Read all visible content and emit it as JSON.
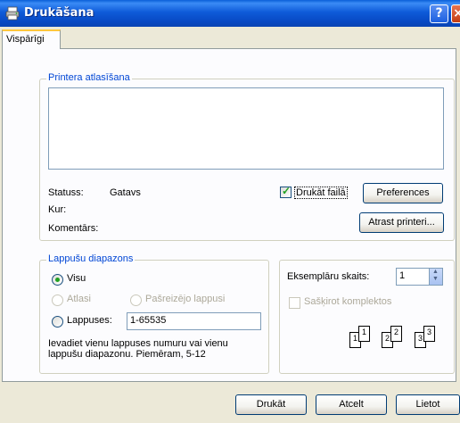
{
  "window": {
    "title": "Drukāšana",
    "help_label": "?",
    "close_label": "×"
  },
  "tabs": [
    "Vispārīgi"
  ],
  "printer_selection": {
    "title": "Printera atlasīšana",
    "status_label": "Statuss:",
    "status_value": "Gatavs",
    "location_label": "Kur:",
    "comment_label": "Komentārs:",
    "print_to_file_label": "Drukāt failā",
    "print_to_file_checked": true,
    "preferences_label": "Preferences",
    "find_printer_label": "Atrast printeri..."
  },
  "page_range": {
    "title": "Lappušu diapazons",
    "all_label": "Visu",
    "selection_label": "Atlasi",
    "current_page_label": "Pašreizējo lappusi",
    "pages_label": "Lappuses:",
    "pages_value": "1-65535",
    "hint_line1": "Ievadiet vienu lappuses numuru vai vienu",
    "hint_line2": "lappušu diapazonu. Piemēram, 5-12"
  },
  "copies": {
    "count_label": "Eksemplāru skaits:",
    "count_value": "1",
    "collate_label": "Sašķirot komplektos",
    "collate_checked": false,
    "page_icons": [
      "1",
      "1",
      "2",
      "2",
      "3",
      "3"
    ]
  },
  "footer": {
    "print_label": "Drukāt",
    "cancel_label": "Atcelt",
    "apply_label": "Lietot"
  },
  "colors": {
    "title_bar": "#0a5fd8",
    "group_title": "#0046d5",
    "dialog_bg": "#ece9d8",
    "checkmark": "#21a121"
  }
}
